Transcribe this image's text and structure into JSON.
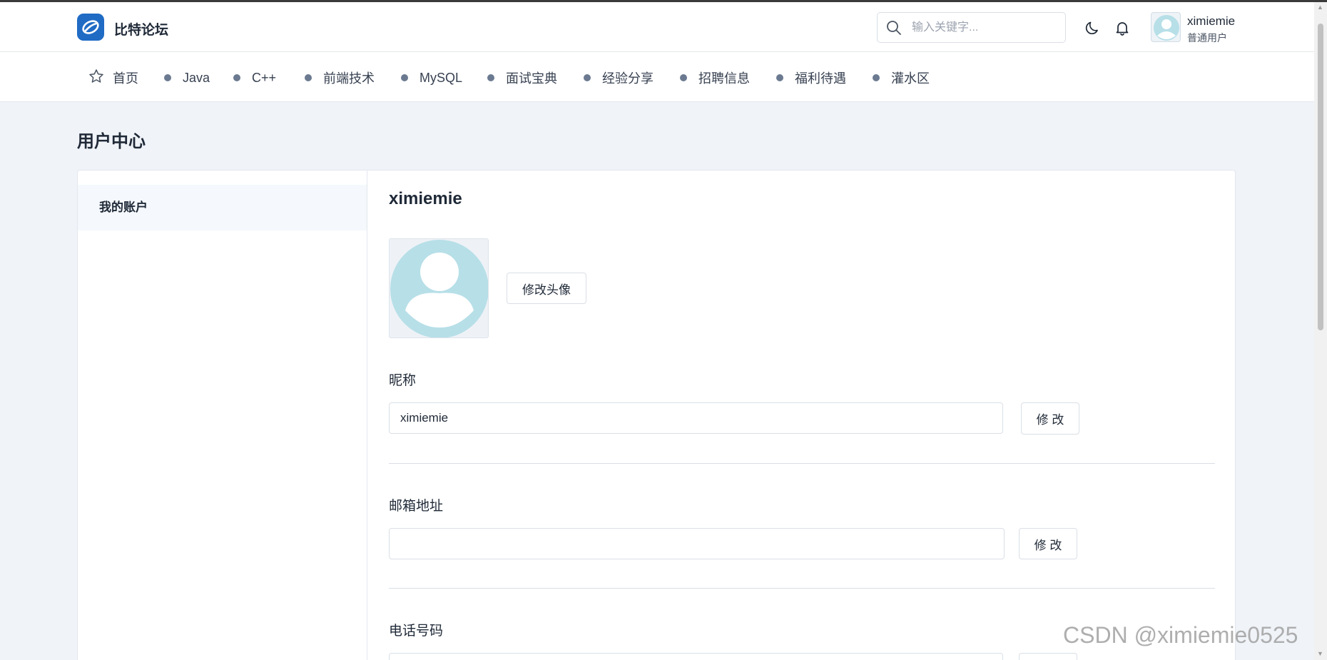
{
  "header": {
    "brand": "比特论坛",
    "search_placeholder": "输入关键字...",
    "user_name": "ximiemie",
    "user_role": "普通用户"
  },
  "nav": {
    "home": "首页",
    "items": [
      "Java",
      "C++",
      "前端技术",
      "MySQL",
      "面试宝典",
      "经验分享",
      "招聘信息",
      "福利待遇",
      "灌水区"
    ]
  },
  "page": {
    "title": "用户中心",
    "sidebar_item": "我的账户"
  },
  "account": {
    "name": "ximiemie",
    "change_avatar": "修改头像",
    "nickname_label": "昵称",
    "nickname_value": "ximiemie",
    "email_label": "邮箱地址",
    "email_value": "",
    "phone_label": "电话号码",
    "modify": "修 改"
  },
  "watermark": "CSDN @ximiemie0525",
  "colors": {
    "brand_blue": "#206bc4",
    "avatar_blue": "#b7dfe8"
  }
}
